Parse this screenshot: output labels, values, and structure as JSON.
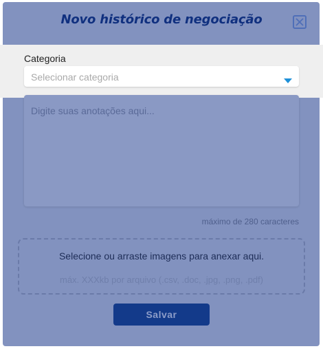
{
  "modal": {
    "title": "Novo histórico de negociação",
    "close_icon": "close-icon"
  },
  "category": {
    "label": "Categoria",
    "selected": "Selecionar categoria",
    "caret_icon": "chevron-down-icon"
  },
  "notes": {
    "placeholder": "Digite suas anotações aqui...",
    "limit_text": "máximo de 280 caracteres"
  },
  "attachments": {
    "instruction": "Selecione ou arraste imagens para anexar aqui.",
    "hint": "máx. XXXkb por arquivo (.csv, .doc, .jpg, .png, .pdf)"
  },
  "actions": {
    "save_label": "Salvar"
  },
  "colors": {
    "overlay": "#8292bf",
    "title": "#10307f",
    "accent_caret": "#1e90d8",
    "save_button": "#133a8a"
  }
}
